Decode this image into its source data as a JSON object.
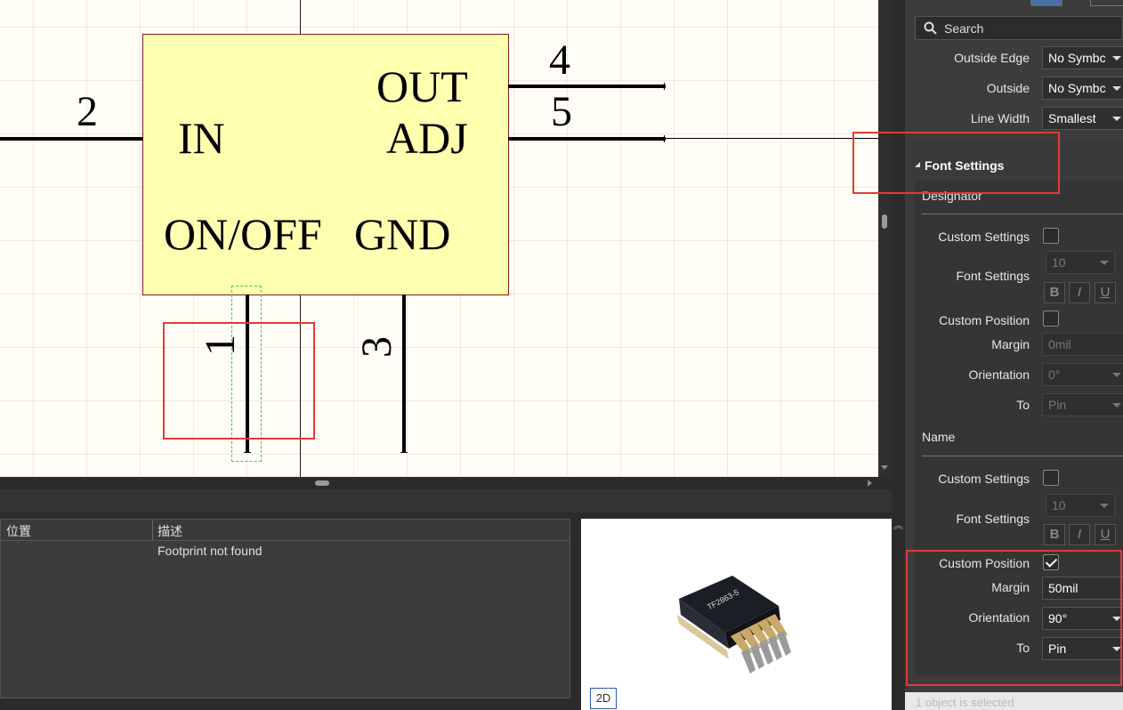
{
  "schematic": {
    "pins": {
      "in": {
        "number": "2",
        "name": "IN"
      },
      "out": {
        "number": "4",
        "name": "OUT"
      },
      "adj": {
        "number": "5",
        "name": "ADJ"
      },
      "onoff": {
        "number": "1",
        "name": "ON/OFF"
      },
      "gnd": {
        "number": "3",
        "name": "GND"
      }
    }
  },
  "messages": {
    "columns": [
      "位置",
      "描述"
    ],
    "rows": [
      {
        "location": "",
        "description": "Footprint not found"
      }
    ]
  },
  "preview": {
    "button_2d": "2D",
    "chip_marking": "TF2863-5"
  },
  "properties": {
    "search_placeholder": "Search",
    "outside_edge": {
      "label": "Outside Edge",
      "value": "No Symbc"
    },
    "outside": {
      "label": "Outside",
      "value": "No Symbc"
    },
    "line_width": {
      "label": "Line Width",
      "value": "Smallest"
    },
    "font_settings_title": "Font Settings",
    "designator": {
      "title": "Designator",
      "custom_settings": {
        "label": "Custom Settings",
        "checked": false
      },
      "font_settings": {
        "label": "Font Settings",
        "size": "10"
      },
      "custom_position": {
        "label": "Custom Position",
        "checked": false
      },
      "margin": {
        "label": "Margin",
        "value": "0mil"
      },
      "orientation": {
        "label": "Orientation",
        "value": "0°"
      },
      "to": {
        "label": "To",
        "value": "Pin"
      }
    },
    "name": {
      "title": "Name",
      "custom_settings": {
        "label": "Custom Settings",
        "checked": false
      },
      "font_settings": {
        "label": "Font Settings",
        "size": "10"
      },
      "custom_position": {
        "label": "Custom Position",
        "checked": true
      },
      "margin": {
        "label": "Margin",
        "value": "50mil"
      },
      "orientation": {
        "label": "Orientation",
        "value": "90°"
      },
      "to": {
        "label": "To",
        "value": "Pin"
      }
    },
    "format_buttons": {
      "bold": "B",
      "italic": "I",
      "underline": "U"
    },
    "status": "1 object is selected"
  },
  "colors": {
    "highlight": "#e53935",
    "component_fill": "#ffffb0",
    "component_border": "#8b1a1a"
  }
}
